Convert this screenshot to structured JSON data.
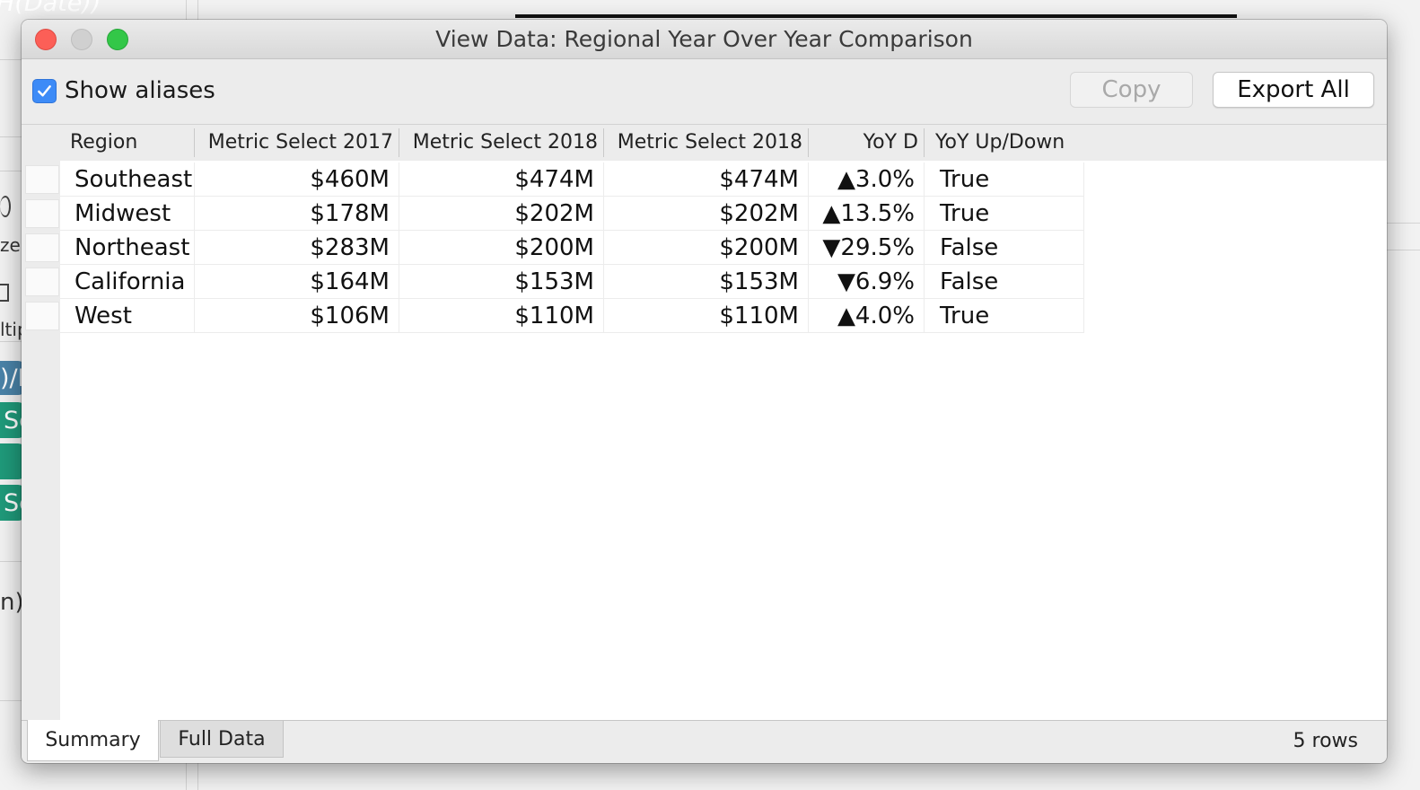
{
  "background": {
    "pills": [
      {
        "text": "H(Date))",
        "color": "#3e7fb0"
      },
      {
        "text": ")/D",
        "color": "#4a83a8"
      },
      {
        "text": "Se",
        "color": "#1f9a7a"
      },
      {
        "text": "",
        "color": "#1f9a7a"
      },
      {
        "text": "Se",
        "color": "#1f9a7a"
      }
    ],
    "fragments": [
      "ze",
      "ltip",
      "n)"
    ]
  },
  "window": {
    "title": "View Data:  Regional Year Over Year Comparison"
  },
  "toolbar": {
    "show_aliases_label": "Show aliases",
    "show_aliases_checked": true,
    "copy_label": "Copy",
    "export_label": "Export All"
  },
  "table": {
    "columns": [
      "Region",
      "Metric Select 2017",
      "Metric Select 2018",
      "Metric Select 2018",
      "YoY D",
      "YoY Up/Down"
    ],
    "rows": [
      [
        "Southeast",
        "$460M",
        "$474M",
        "$474M",
        "▲3.0%",
        "True"
      ],
      [
        "Midwest",
        "$178M",
        "$202M",
        "$202M",
        "▲13.5%",
        "True"
      ],
      [
        "Northeast",
        "$283M",
        "$200M",
        "$200M",
        "▼29.5%",
        "False"
      ],
      [
        "California",
        "$164M",
        "$153M",
        "$153M",
        "▼6.9%",
        "False"
      ],
      [
        "West",
        "$106M",
        "$110M",
        "$110M",
        "▲4.0%",
        "True"
      ]
    ]
  },
  "tabs": [
    {
      "label": "Summary",
      "active": true
    },
    {
      "label": "Full Data",
      "active": false
    }
  ],
  "status": {
    "row_count": "5 rows"
  },
  "colors": {
    "accent": "#3d8bf7",
    "close": "#fc5f57",
    "maximize": "#33c748"
  }
}
